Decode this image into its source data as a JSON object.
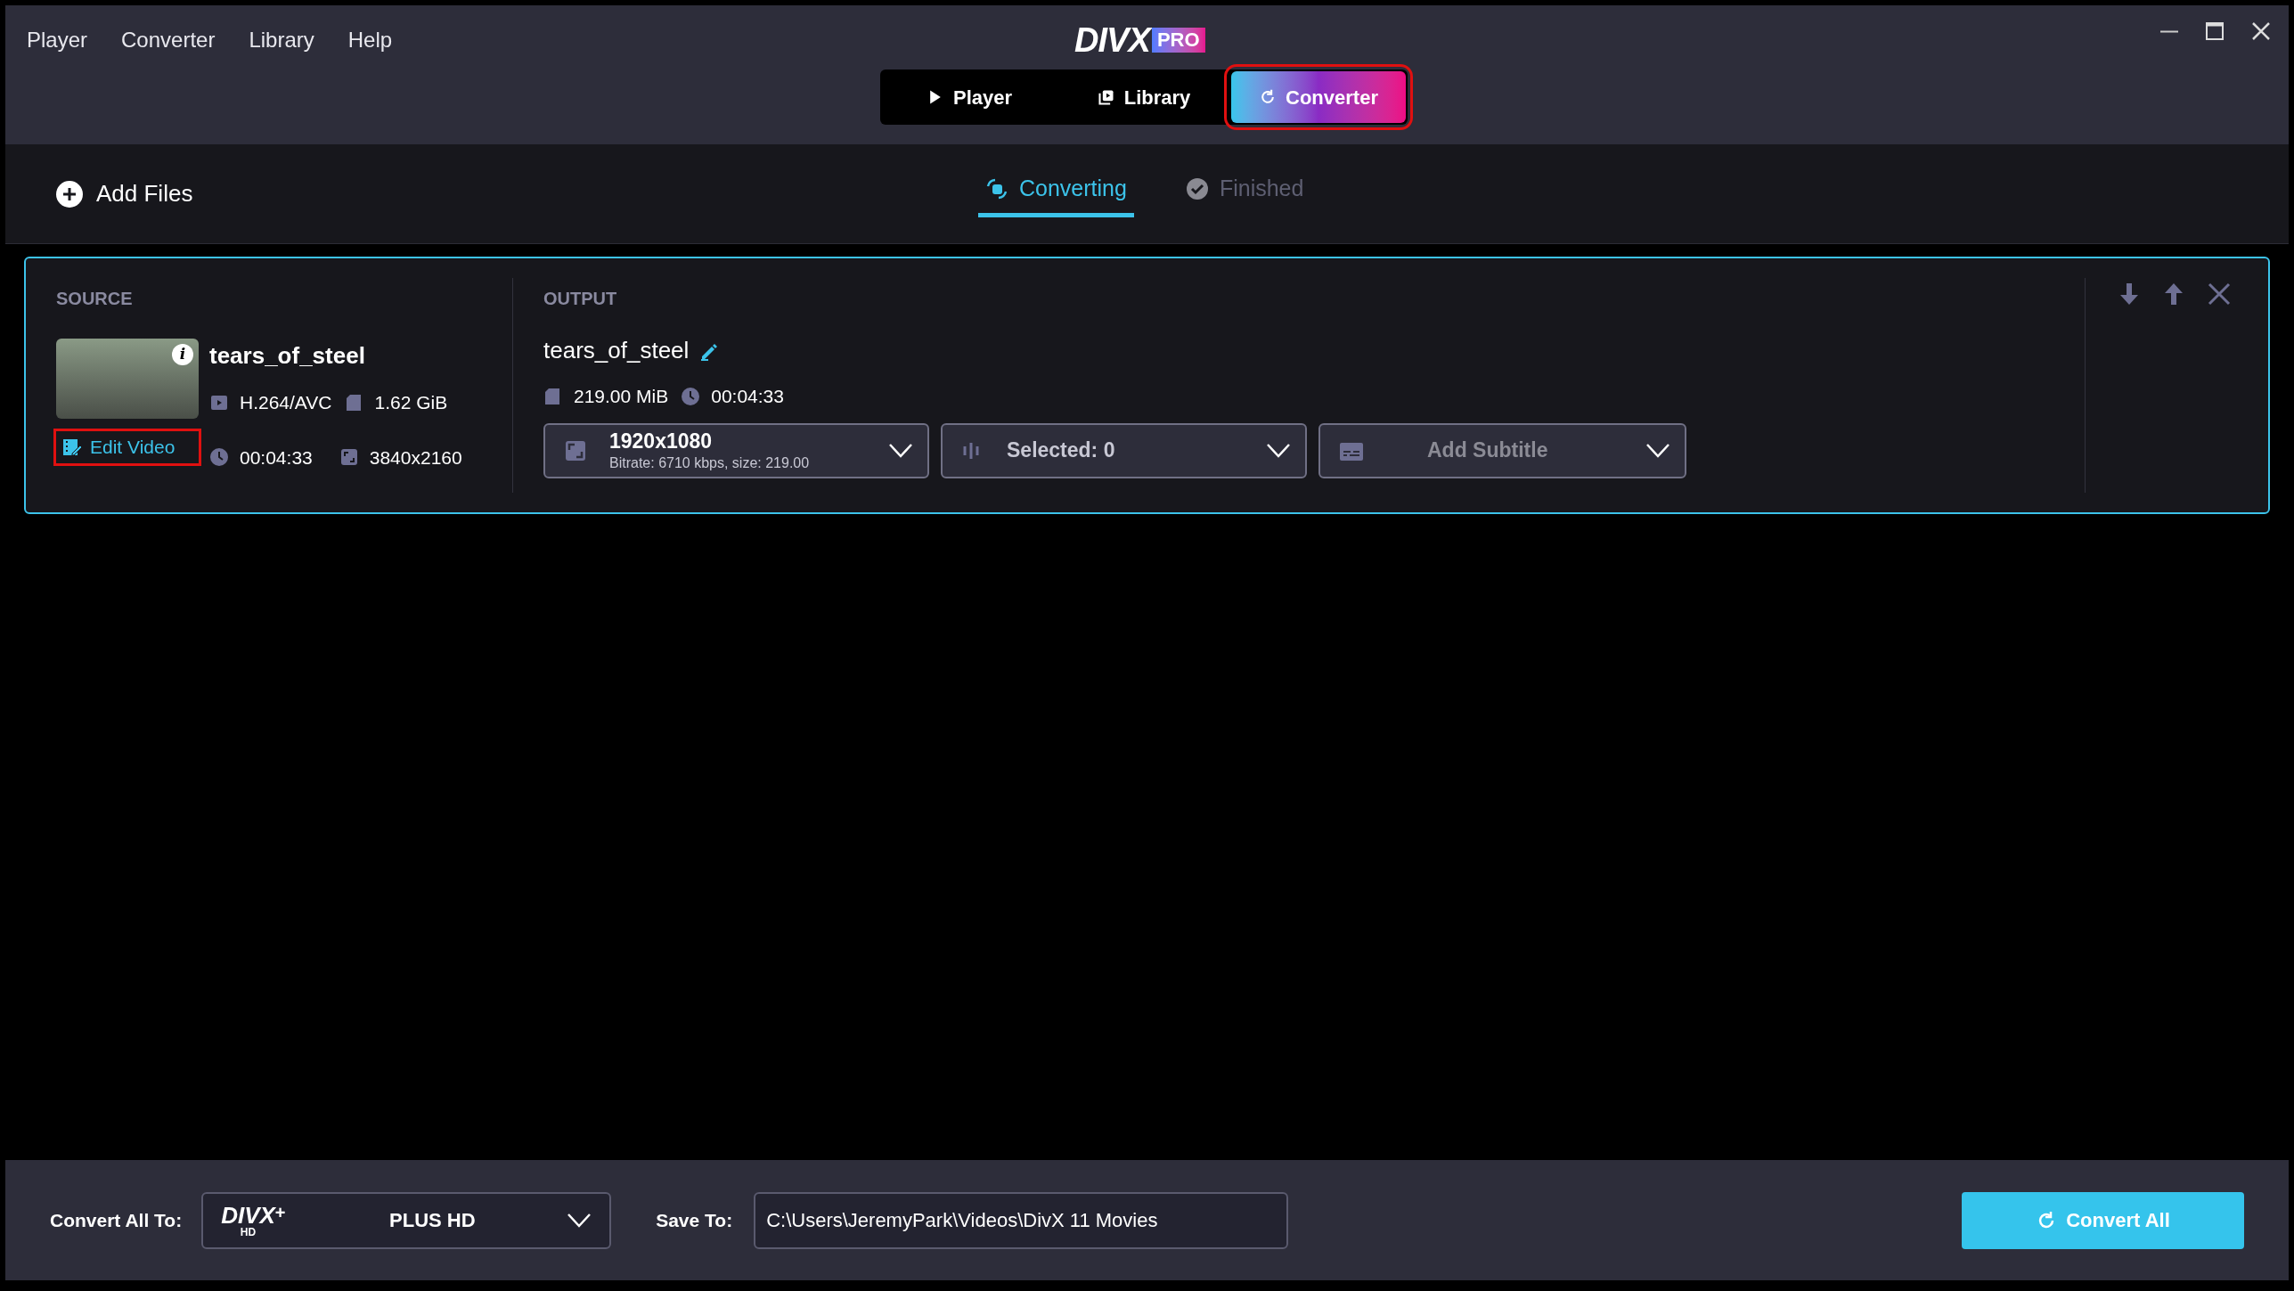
{
  "menu": [
    "Player",
    "Converter",
    "Library",
    "Help"
  ],
  "logo": {
    "brand": "DIVX",
    "badge": "PRO"
  },
  "nav_tabs": [
    {
      "label": "Player",
      "kind": "play",
      "selected": false,
      "highlighted": false
    },
    {
      "label": "Library",
      "kind": "library",
      "selected": false,
      "highlighted": false
    },
    {
      "label": "Converter",
      "kind": "convert",
      "selected": true,
      "highlighted": true
    }
  ],
  "toolbar": {
    "add_files": "Add Files"
  },
  "view_tabs": [
    {
      "label": "Converting",
      "selected": true
    },
    {
      "label": "Finished",
      "selected": false
    }
  ],
  "job": {
    "source_heading": "SOURCE",
    "thumbnail_info": "i",
    "name": "tears_of_steel",
    "codec": "H.264/AVC",
    "size": "1.62 GiB",
    "duration": "00:04:33",
    "resolution": "3840x2160",
    "edit_video": {
      "label": "Edit Video",
      "highlighted": true
    },
    "output_heading": "OUTPUT",
    "output_name": "tears_of_steel",
    "output_size": "219.00 MiB",
    "output_duration": "00:04:33",
    "dropdowns": [
      {
        "kind": "resolution",
        "title": "1920x1080",
        "subtitle": "Bitrate: 6710 kbps, size: 219.00"
      },
      {
        "kind": "audio",
        "title": "Selected: 0"
      },
      {
        "kind": "subtitle",
        "title": "Add Subtitle"
      }
    ]
  },
  "footer": {
    "convert_all_to_label": "Convert All To:",
    "format": {
      "brand": "DIVX",
      "plus": "+",
      "hd": "HD",
      "name": "PLUS HD"
    },
    "save_to_label": "Save To:",
    "save_path": "C:\\Users\\JeremyPark\\Videos\\DivX 11 Movies",
    "convert_all": "Convert All"
  }
}
